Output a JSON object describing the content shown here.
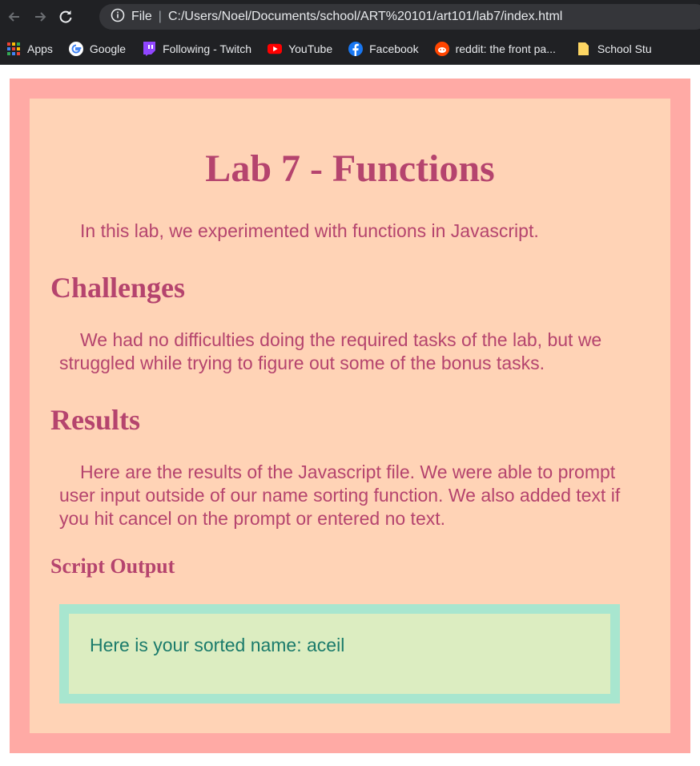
{
  "browser": {
    "address": {
      "file_label": "File",
      "url": "C:/Users/Noel/Documents/school/ART%20101/art101/lab7/index.html"
    },
    "bookmarks": [
      {
        "label": "Apps",
        "icon": "apps-grid-icon"
      },
      {
        "label": "Google",
        "icon": "google-icon"
      },
      {
        "label": "Following - Twitch",
        "icon": "twitch-icon"
      },
      {
        "label": "YouTube",
        "icon": "youtube-icon"
      },
      {
        "label": "Facebook",
        "icon": "facebook-icon"
      },
      {
        "label": "reddit: the front pa...",
        "icon": "reddit-icon"
      },
      {
        "label": "School Stu",
        "icon": "folder-icon"
      }
    ]
  },
  "page": {
    "title": "Lab 7 - Functions",
    "intro": "In this lab, we experimented with functions in Javascript.",
    "challenges_heading": "Challenges",
    "challenges_text": "We had no difficulties doing the required tasks of the lab, but we struggled while trying to figure out some of the bonus tasks.",
    "results_heading": "Results",
    "results_text": "Here are the results of the Javascript file. We were able to prompt user input outside of our name sorting function. We also added text if you hit cancel on the prompt or entered no text.",
    "script_output_heading": "Script Output",
    "output_text": "Here is your sorted name: aceil"
  },
  "colors": {
    "outer_frame": "#ffaaa5",
    "inner_background": "#ffd3b6",
    "text": "#b5446e",
    "output_border": "#a8e6cf",
    "output_background": "#dcedc1",
    "output_text": "#1b7b6b"
  }
}
